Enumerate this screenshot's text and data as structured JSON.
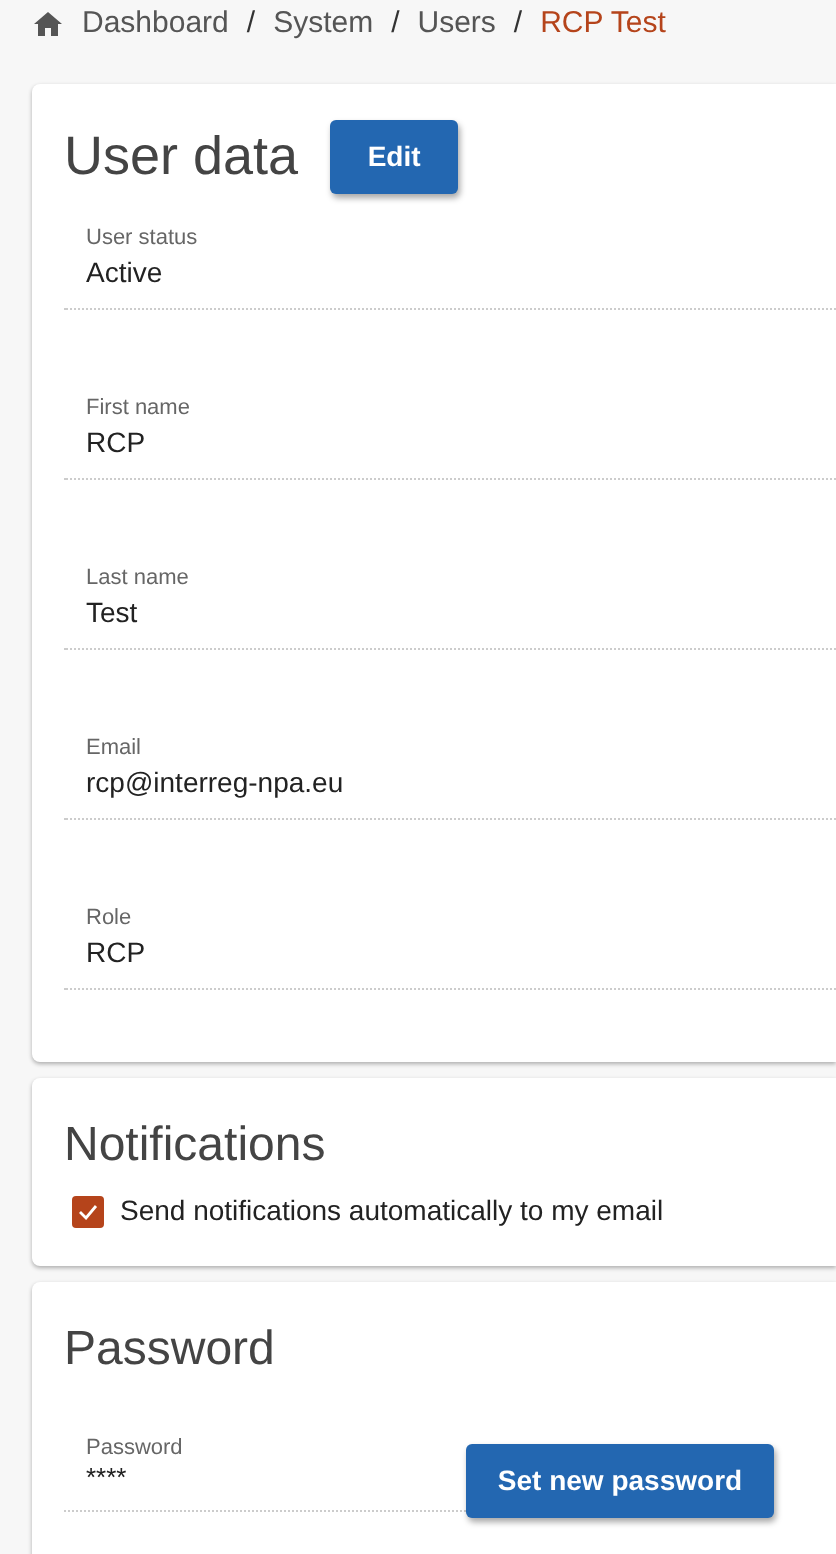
{
  "breadcrumb": [
    {
      "label": "Dashboard",
      "current": false
    },
    {
      "label": "System",
      "current": false
    },
    {
      "label": "Users",
      "current": false
    },
    {
      "label": "RCP Test",
      "current": true
    }
  ],
  "breadcrumb_separator": "/",
  "user_data": {
    "title": "User data",
    "edit_button": "Edit",
    "fields": [
      {
        "label": "User status",
        "value": "Active"
      },
      {
        "label": "First name",
        "value": "RCP"
      },
      {
        "label": "Last name",
        "value": "Test"
      },
      {
        "label": "Email",
        "value": "rcp@interreg-npa.eu"
      },
      {
        "label": "Role",
        "value": "RCP"
      }
    ]
  },
  "notifications": {
    "title": "Notifications",
    "option": {
      "label": "Send notifications automatically to my email",
      "checked": true
    }
  },
  "password": {
    "title": "Password",
    "label": "Password",
    "value": "****",
    "button": "Set new password"
  }
}
